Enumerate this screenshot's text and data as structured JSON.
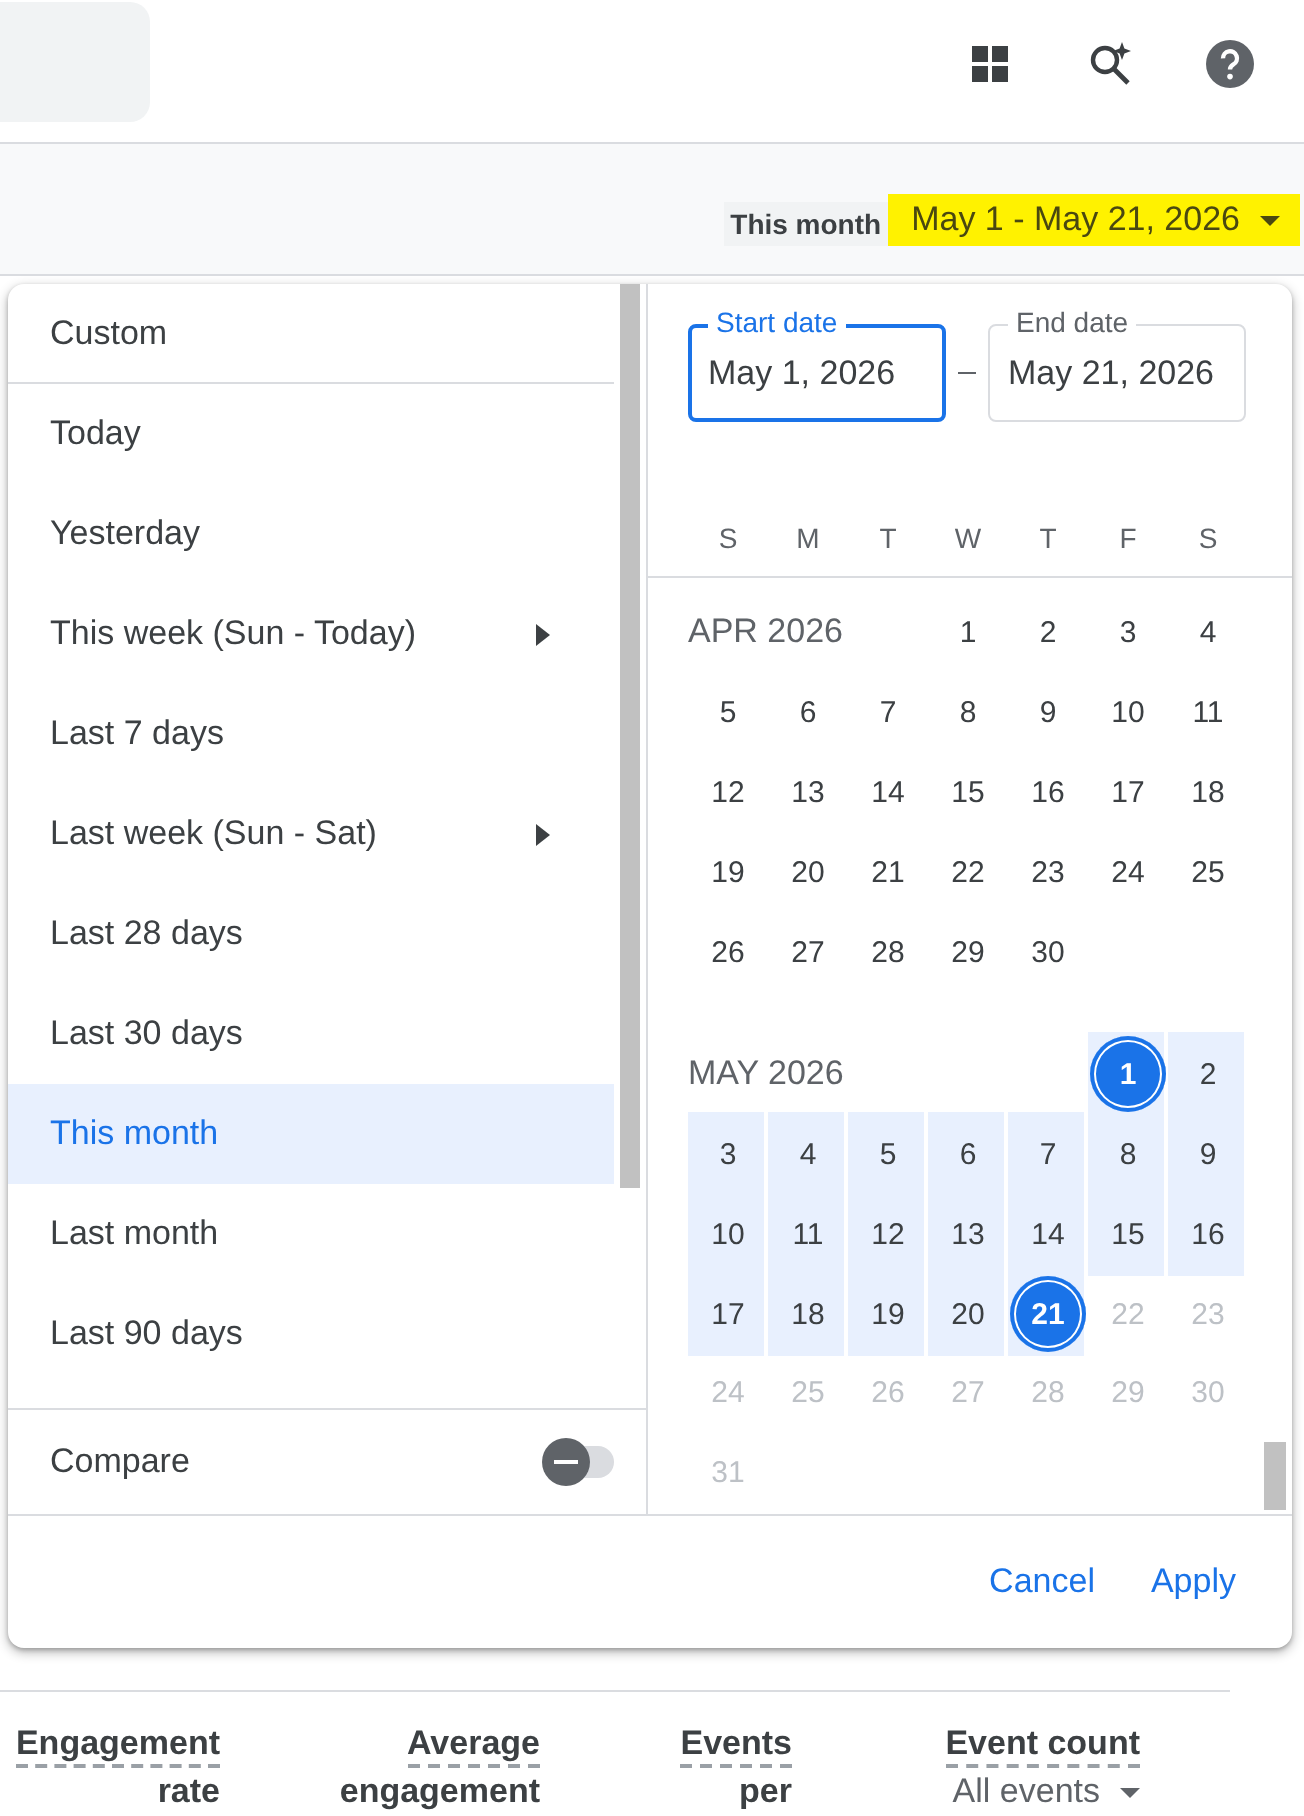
{
  "date_bar": {
    "label": "This month",
    "range": "May 1 - May 21, 2026"
  },
  "presets": [
    {
      "label": "Custom",
      "selected": false,
      "has_submenu": false
    },
    {
      "label": "Today",
      "selected": false,
      "has_submenu": false
    },
    {
      "label": "Yesterday",
      "selected": false,
      "has_submenu": false
    },
    {
      "label": "This week (Sun - Today)",
      "selected": false,
      "has_submenu": true
    },
    {
      "label": "Last 7 days",
      "selected": false,
      "has_submenu": false
    },
    {
      "label": "Last week (Sun - Sat)",
      "selected": false,
      "has_submenu": true
    },
    {
      "label": "Last 28 days",
      "selected": false,
      "has_submenu": false
    },
    {
      "label": "Last 30 days",
      "selected": false,
      "has_submenu": false
    },
    {
      "label": "This month",
      "selected": true,
      "has_submenu": false
    },
    {
      "label": "Last month",
      "selected": false,
      "has_submenu": false
    },
    {
      "label": "Last 90 days",
      "selected": false,
      "has_submenu": false
    }
  ],
  "compare": {
    "label": "Compare",
    "on": false
  },
  "fields": [
    {
      "label": "Start date",
      "value": "May 1, 2026",
      "focused": true
    },
    {
      "label": "End date",
      "value": "May 21, 2026",
      "focused": false
    }
  ],
  "weekdays": [
    "S",
    "M",
    "T",
    "W",
    "T",
    "F",
    "S"
  ],
  "calendar": {
    "months": [
      {
        "label": "APR 2026",
        "weeks": [
          [
            {
              "text": "1",
              "in_range": false,
              "disabled": false,
              "selected": false
            },
            {
              "text": "2",
              "in_range": false,
              "disabled": false,
              "selected": false
            },
            {
              "text": "3",
              "in_range": false,
              "disabled": false,
              "selected": false
            },
            {
              "text": "4",
              "in_range": false,
              "disabled": false,
              "selected": false
            }
          ],
          [
            {
              "text": "5",
              "in_range": false,
              "disabled": false,
              "selected": false
            },
            {
              "text": "6",
              "in_range": false,
              "disabled": false,
              "selected": false
            },
            {
              "text": "7",
              "in_range": false,
              "disabled": false,
              "selected": false
            },
            {
              "text": "8",
              "in_range": false,
              "disabled": false,
              "selected": false
            },
            {
              "text": "9",
              "in_range": false,
              "disabled": false,
              "selected": false
            },
            {
              "text": "10",
              "in_range": false,
              "disabled": false,
              "selected": false
            },
            {
              "text": "11",
              "in_range": false,
              "disabled": false,
              "selected": false
            }
          ],
          [
            {
              "text": "12",
              "in_range": false,
              "disabled": false,
              "selected": false
            },
            {
              "text": "13",
              "in_range": false,
              "disabled": false,
              "selected": false
            },
            {
              "text": "14",
              "in_range": false,
              "disabled": false,
              "selected": false
            },
            {
              "text": "15",
              "in_range": false,
              "disabled": false,
              "selected": false
            },
            {
              "text": "16",
              "in_range": false,
              "disabled": false,
              "selected": false
            },
            {
              "text": "17",
              "in_range": false,
              "disabled": false,
              "selected": false
            },
            {
              "text": "18",
              "in_range": false,
              "disabled": false,
              "selected": false
            }
          ],
          [
            {
              "text": "19",
              "in_range": false,
              "disabled": false,
              "selected": false
            },
            {
              "text": "20",
              "in_range": false,
              "disabled": false,
              "selected": false
            },
            {
              "text": "21",
              "in_range": false,
              "disabled": false,
              "selected": false
            },
            {
              "text": "22",
              "in_range": false,
              "disabled": false,
              "selected": false
            },
            {
              "text": "23",
              "in_range": false,
              "disabled": false,
              "selected": false
            },
            {
              "text": "24",
              "in_range": false,
              "disabled": false,
              "selected": false
            },
            {
              "text": "25",
              "in_range": false,
              "disabled": false,
              "selected": false
            }
          ],
          [
            {
              "text": "26",
              "in_range": false,
              "disabled": false,
              "selected": false
            },
            {
              "text": "27",
              "in_range": false,
              "disabled": false,
              "selected": false
            },
            {
              "text": "28",
              "in_range": false,
              "disabled": false,
              "selected": false
            },
            {
              "text": "29",
              "in_range": false,
              "disabled": false,
              "selected": false
            },
            {
              "text": "30",
              "in_range": false,
              "disabled": false,
              "selected": false
            }
          ]
        ]
      },
      {
        "label": "MAY 2026",
        "weeks": [
          [
            {
              "text": "1",
              "in_range": true,
              "disabled": false,
              "selected": true
            },
            {
              "text": "2",
              "in_range": true,
              "disabled": false,
              "selected": false
            }
          ],
          [
            {
              "text": "3",
              "in_range": true,
              "disabled": false,
              "selected": false
            },
            {
              "text": "4",
              "in_range": true,
              "disabled": false,
              "selected": false
            },
            {
              "text": "5",
              "in_range": true,
              "disabled": false,
              "selected": false
            },
            {
              "text": "6",
              "in_range": true,
              "disabled": false,
              "selected": false
            },
            {
              "text": "7",
              "in_range": true,
              "disabled": false,
              "selected": false
            },
            {
              "text": "8",
              "in_range": true,
              "disabled": false,
              "selected": false
            },
            {
              "text": "9",
              "in_range": true,
              "disabled": false,
              "selected": false
            }
          ],
          [
            {
              "text": "10",
              "in_range": true,
              "disabled": false,
              "selected": false
            },
            {
              "text": "11",
              "in_range": true,
              "disabled": false,
              "selected": false
            },
            {
              "text": "12",
              "in_range": true,
              "disabled": false,
              "selected": false
            },
            {
              "text": "13",
              "in_range": true,
              "disabled": false,
              "selected": false
            },
            {
              "text": "14",
              "in_range": true,
              "disabled": false,
              "selected": false
            },
            {
              "text": "15",
              "in_range": true,
              "disabled": false,
              "selected": false
            },
            {
              "text": "16",
              "in_range": true,
              "disabled": false,
              "selected": false
            }
          ],
          [
            {
              "text": "17",
              "in_range": true,
              "disabled": false,
              "selected": false
            },
            {
              "text": "18",
              "in_range": true,
              "disabled": false,
              "selected": false
            },
            {
              "text": "19",
              "in_range": true,
              "disabled": false,
              "selected": false
            },
            {
              "text": "20",
              "in_range": true,
              "disabled": false,
              "selected": false
            },
            {
              "text": "21",
              "in_range": true,
              "disabled": false,
              "selected": true
            },
            {
              "text": "22",
              "in_range": false,
              "disabled": true,
              "selected": false
            },
            {
              "text": "23",
              "in_range": false,
              "disabled": true,
              "selected": false
            }
          ],
          [
            {
              "text": "24",
              "in_range": false,
              "disabled": true,
              "selected": false
            },
            {
              "text": "25",
              "in_range": false,
              "disabled": true,
              "selected": false
            },
            {
              "text": "26",
              "in_range": false,
              "disabled": true,
              "selected": false
            },
            {
              "text": "27",
              "in_range": false,
              "disabled": true,
              "selected": false
            },
            {
              "text": "28",
              "in_range": false,
              "disabled": true,
              "selected": false
            },
            {
              "text": "29",
              "in_range": false,
              "disabled": true,
              "selected": false
            },
            {
              "text": "30",
              "in_range": false,
              "disabled": true,
              "selected": false
            }
          ],
          [
            {
              "text": "31",
              "in_range": false,
              "disabled": true,
              "selected": false
            }
          ]
        ]
      }
    ]
  },
  "actions": [
    "Cancel",
    "Apply"
  ],
  "table": {
    "columns": [
      {
        "lines": [
          "Engagement",
          "rate"
        ]
      },
      {
        "lines": [
          "Average",
          "engagement"
        ]
      },
      {
        "lines": [
          "Events",
          "per"
        ]
      },
      {
        "lines": [
          "Event count"
        ],
        "filter": "All events"
      }
    ]
  }
}
